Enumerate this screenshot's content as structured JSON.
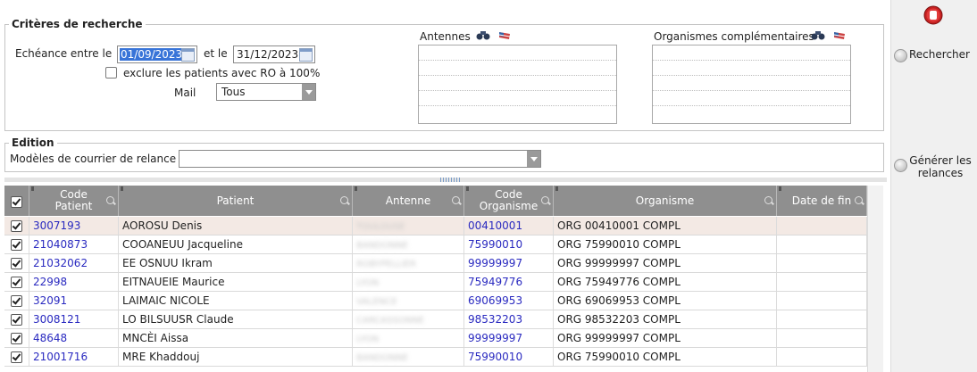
{
  "criteria": {
    "legend": "Critères de recherche",
    "echeance_label": "Echéance entre le",
    "date_from": "01/09/2023",
    "et_le": "et le",
    "date_to": "31/12/2023",
    "exclude_label": "exclure les patients avec RO à 100%",
    "mail_label": "Mail",
    "mail_value": "Tous",
    "antennes_label": "Antennes",
    "organismes_label": "Organismes complémentaires"
  },
  "edition": {
    "legend": "Edition",
    "modeles_label": "Modèles de courrier de relance",
    "modeles_value": ""
  },
  "side": {
    "rechercher": "Rechercher",
    "generer_line1": "Générer les",
    "generer_line2": "relances"
  },
  "grid": {
    "columns": {
      "code_patient_1": "Code",
      "code_patient_2": "Patient",
      "patient": "Patient",
      "antenne": "Antenne",
      "code_org_1": "Code",
      "code_org_2": "Organisme",
      "organisme": "Organisme",
      "date_fin": "Date de fin"
    },
    "rows": [
      {
        "code": "3007193",
        "patient": "AOROSU Denis",
        "antenne": "TOULOUSE",
        "code_org": "00410001",
        "organisme": "ORG 00410001 COMPL",
        "date_fin": ""
      },
      {
        "code": "21040873",
        "patient": "COOANEUU Jacqueline",
        "antenne": "BANDONNE",
        "code_org": "75990010",
        "organisme": "ORG 75990010 COMPL",
        "date_fin": ""
      },
      {
        "code": "21032062",
        "patient": "EE OSNUU Ikram",
        "antenne": "ROBYPELLIER",
        "code_org": "99999997",
        "organisme": "ORG 99999997 COMPL",
        "date_fin": ""
      },
      {
        "code": "22998",
        "patient": "EITNAUEIE Maurice",
        "antenne": "LYON",
        "code_org": "75949776",
        "organisme": "ORG 75949776 COMPL",
        "date_fin": ""
      },
      {
        "code": "32091",
        "patient": "LAIMAIC NICOLE",
        "antenne": "VALENCE",
        "code_org": "69069953",
        "organisme": "ORG 69069953 COMPL",
        "date_fin": ""
      },
      {
        "code": "3008121",
        "patient": "LO BILSUUSR Claude",
        "antenne": "CARCASSONNE",
        "code_org": "98532203",
        "organisme": "ORG 98532203 COMPL",
        "date_fin": ""
      },
      {
        "code": "48648",
        "patient": "MNCÈI Aissa",
        "antenne": "LYON",
        "code_org": "99999997",
        "organisme": "ORG 99999997 COMPL",
        "date_fin": ""
      },
      {
        "code": "21001716",
        "patient": "MRE Khaddouj",
        "antenne": "BANDONNE",
        "code_org": "75990010",
        "organisme": "ORG 75990010 COMPL",
        "date_fin": ""
      }
    ]
  }
}
